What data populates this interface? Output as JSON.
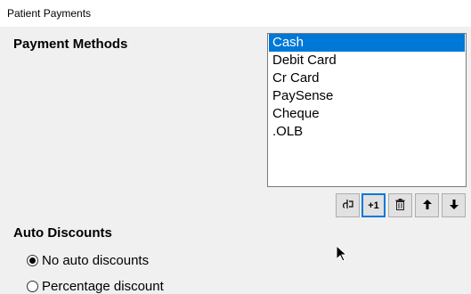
{
  "window": {
    "title": "Patient Payments"
  },
  "payment_methods": {
    "heading": "Payment Methods",
    "items": [
      "Cash",
      "Debit Card",
      "Cr Card",
      "PaySense",
      "Cheque",
      ".OLB"
    ],
    "selected": "Cash"
  },
  "toolbar": {
    "edit_icon": "edit-icon",
    "add_label": "+1",
    "delete_icon": "trash-icon",
    "up_icon": "arrow-up-icon",
    "down_icon": "arrow-down-icon"
  },
  "auto_discounts": {
    "heading": "Auto Discounts",
    "options": [
      {
        "label": "No auto discounts",
        "checked": true
      },
      {
        "label": "Percentage discount",
        "checked": false
      }
    ]
  },
  "colors": {
    "selection": "#0078d7",
    "background": "#f0f0f0"
  }
}
